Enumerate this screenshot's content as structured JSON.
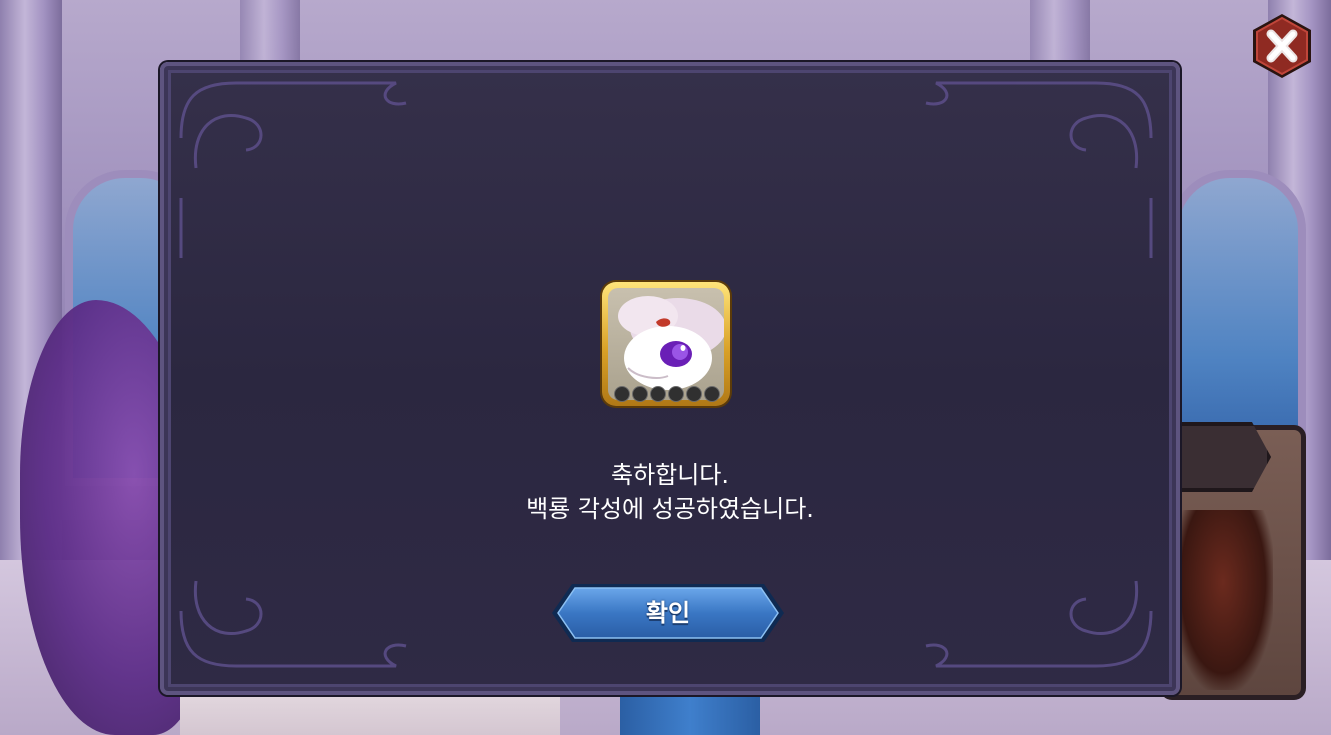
{
  "dialog": {
    "message_line1": "축하합니다.",
    "message_line2": "백룡 각성에 성공하였습니다.",
    "confirm_label": "확인",
    "reward_icon": "white-dragon-portrait-icon",
    "reward_slots": 6
  },
  "close_icon": "close-x-icon",
  "colors": {
    "dialog_bg": "#2b2740",
    "dialog_border": "#5e5480",
    "button_blue": "#3a77c4",
    "icon_gold": "#d9a127",
    "close_red": "#8f2a22"
  }
}
